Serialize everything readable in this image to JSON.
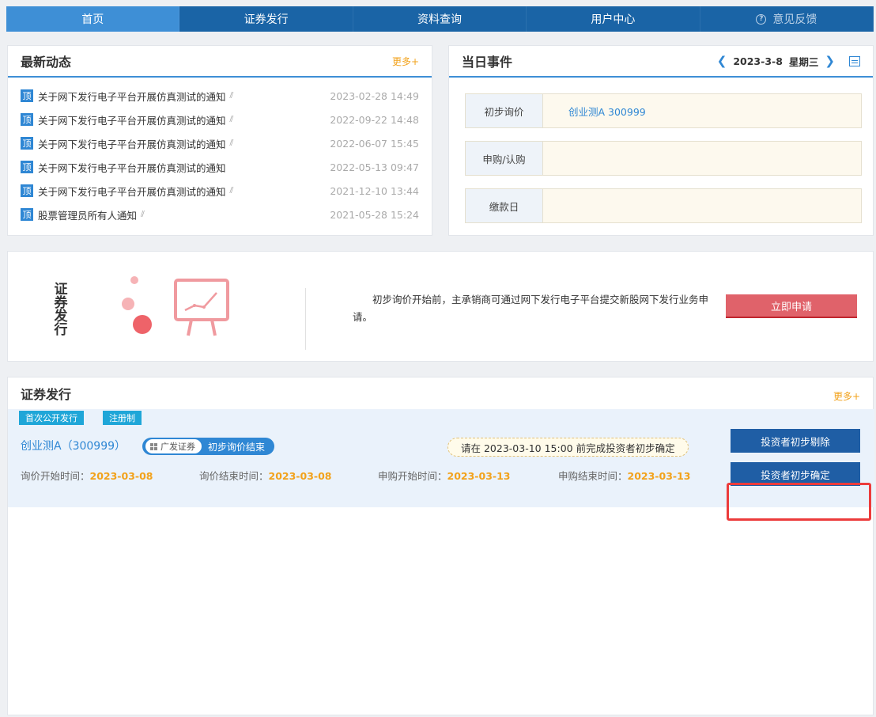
{
  "nav": {
    "tabs": [
      "首页",
      "证券发行",
      "资料查询",
      "用户中心"
    ],
    "feedback": "意见反馈"
  },
  "news": {
    "title": "最新动态",
    "more": "更多+",
    "badge": "顶",
    "items": [
      {
        "title": "关于网下发行电子平台开展仿真测试的通知",
        "date": "2023-02-28 14:49"
      },
      {
        "title": "关于网下发行电子平台开展仿真测试的通知",
        "date": "2022-09-22 14:48"
      },
      {
        "title": "关于网下发行电子平台开展仿真测试的通知",
        "date": "2022-06-07 15:45"
      },
      {
        "title": "关于网下发行电子平台开展仿真测试的通知",
        "date": "2022-05-13 09:47"
      },
      {
        "title": "关于网下发行电子平台开展仿真测试的通知",
        "date": "2021-12-10 13:44"
      },
      {
        "title": "股票管理员所有人通知",
        "date": "2021-05-28 15:24"
      }
    ]
  },
  "events": {
    "title": "当日事件",
    "date": "2023-3-8",
    "weekday": "星期三",
    "rows": [
      {
        "label": "初步询价",
        "value": "创业测A 300999"
      },
      {
        "label": "申购/认购",
        "value": ""
      },
      {
        "label": "缴款日",
        "value": ""
      }
    ]
  },
  "banner": {
    "title": "证券发行",
    "text": "初步询价开始前，主承销商可通过网下发行电子平台提交新股网下发行业务申请。",
    "button": "立即申请"
  },
  "issue": {
    "title": "证券发行",
    "more": "更多+",
    "tags": [
      "首次公开发行",
      "注册制"
    ],
    "stock": "创业测A（300999）",
    "broker": "广发证券",
    "status": "初步询价结束",
    "notice": "请在 2023-03-10 15:00 前完成投资者初步确定",
    "times": [
      {
        "label": "询价开始时间：",
        "value": "2023-03-08"
      },
      {
        "label": "询价结束时间：",
        "value": "2023-03-08"
      },
      {
        "label": "申购开始时间：",
        "value": "2023-03-13"
      },
      {
        "label": "申购结束时间：",
        "value": "2023-03-13"
      }
    ],
    "buttons": [
      "投资者初步剔除",
      "投资者初步确定"
    ]
  },
  "colors": {
    "nav": "#1a64a6",
    "nav_active": "#3e8fd6",
    "accent_orange": "#f2a21b",
    "apply_red": "#e0626a",
    "issue_button": "#1f5ea5",
    "highlight": "#ec3b3b"
  }
}
